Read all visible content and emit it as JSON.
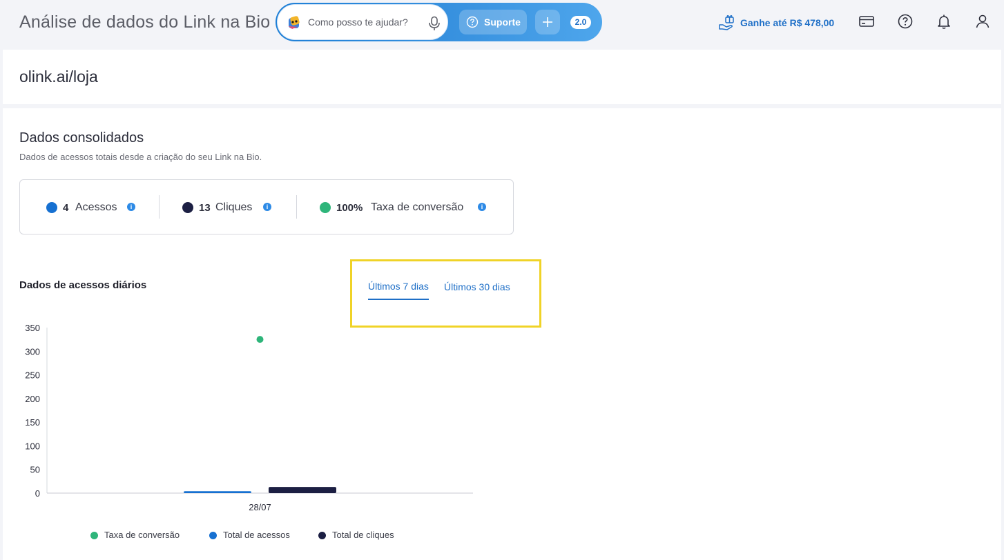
{
  "header": {
    "title": "Análise de dados do Link na Bio",
    "assistant_placeholder": "Como posso te ajudar?",
    "support_label": "Suporte",
    "version_badge": "2.0",
    "earn_label": "Ganhe até R$ 478,00",
    "icons": [
      "payment-card-icon",
      "help-icon",
      "bell-icon",
      "user-icon"
    ]
  },
  "link": {
    "url": "olink.ai/loja"
  },
  "consolidated": {
    "title": "Dados consolidados",
    "subtitle": "Dados de acessos totais desde a criação do seu Link na Bio.",
    "stats": [
      {
        "value": "4",
        "label": "Acessos",
        "color": "#1670d1"
      },
      {
        "value": "13",
        "label": "Cliques",
        "color": "#1c1f43"
      },
      {
        "value": "100%",
        "label": "Taxa de conversão",
        "color": "#2eb57a"
      }
    ]
  },
  "daily": {
    "title": "Dados de acessos diários",
    "tabs": [
      {
        "label": "Últimos 7 dias",
        "active": true
      },
      {
        "label": "Últimos 30 dias",
        "active": false
      }
    ]
  },
  "chart_data": {
    "type": "bar",
    "categories": [
      "28/07"
    ],
    "series": [
      {
        "name": "Taxa de conversão",
        "type": "scatter",
        "color": "#2eb57a",
        "values": [
          325
        ]
      },
      {
        "name": "Total de acessos",
        "type": "bar",
        "color": "#1670d1",
        "values": [
          4
        ]
      },
      {
        "name": "Total de cliques",
        "type": "bar",
        "color": "#1c1f43",
        "values": [
          13
        ]
      }
    ],
    "ylim": [
      0,
      350
    ],
    "yticks": [
      0,
      50,
      100,
      150,
      200,
      250,
      300,
      350
    ],
    "legend": "bottom"
  }
}
